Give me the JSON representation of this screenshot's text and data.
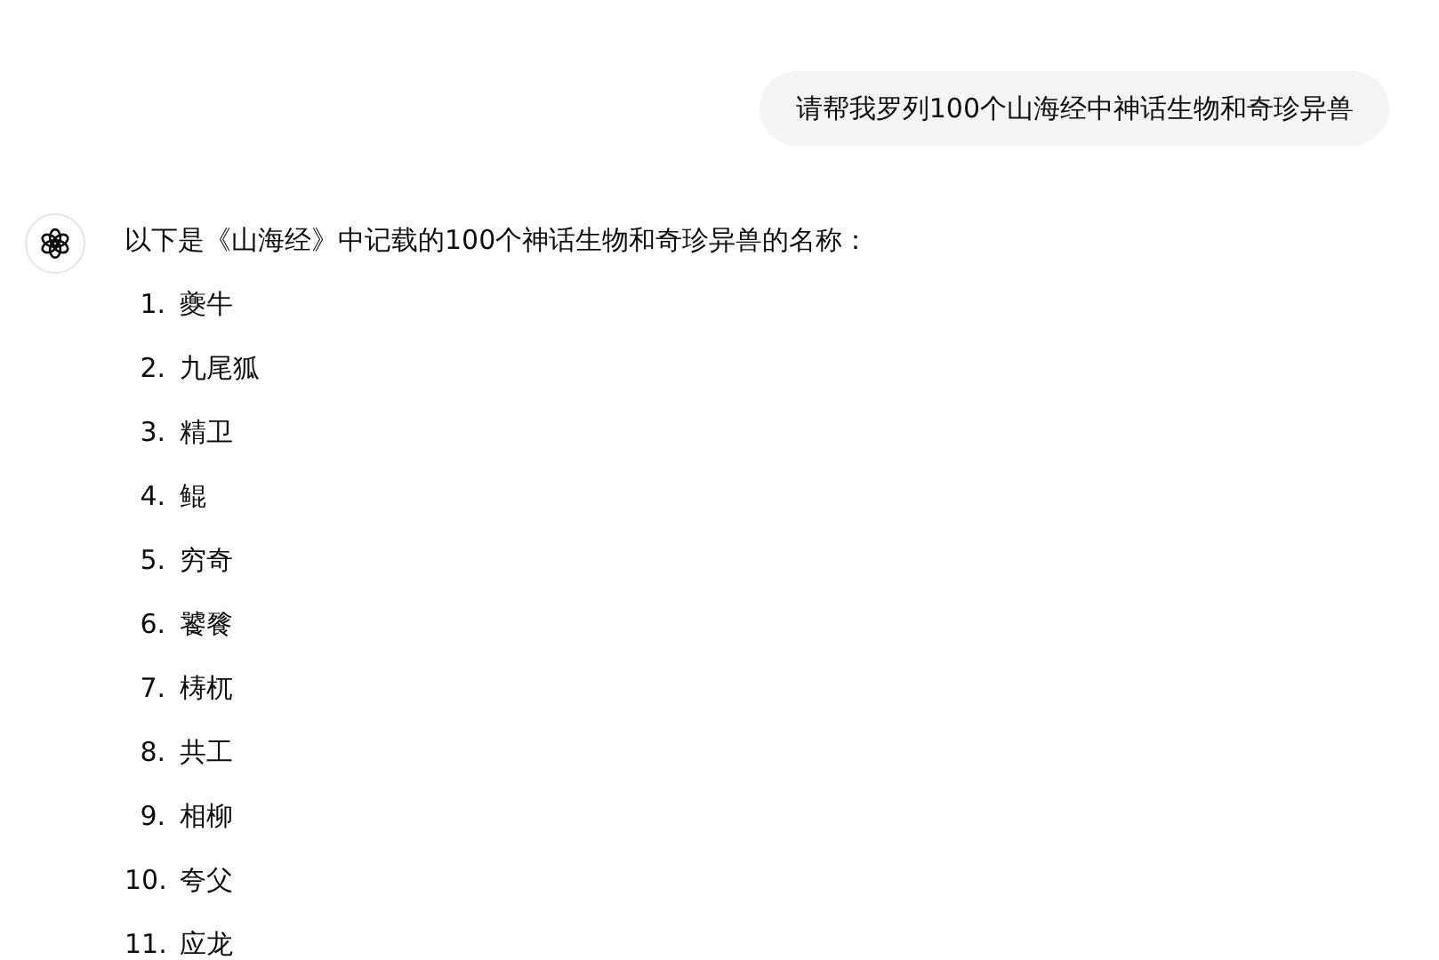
{
  "user_message": {
    "text": "请帮我罗列100个山海经中神话生物和奇珍异兽"
  },
  "assistant_message": {
    "intro": "以下是《山海经》中记载的100个神话生物和奇珍异兽的名称：",
    "items": [
      {
        "number": "1.",
        "name": "夔牛"
      },
      {
        "number": "2.",
        "name": "九尾狐"
      },
      {
        "number": "3.",
        "name": "精卫"
      },
      {
        "number": "4.",
        "name": "鲲"
      },
      {
        "number": "5.",
        "name": "穷奇"
      },
      {
        "number": "6.",
        "name": "饕餮"
      },
      {
        "number": "7.",
        "name": "梼杌"
      },
      {
        "number": "8.",
        "name": "共工"
      },
      {
        "number": "9.",
        "name": "相柳"
      },
      {
        "number": "10.",
        "name": "夸父"
      },
      {
        "number": "11.",
        "name": "应龙"
      }
    ]
  }
}
